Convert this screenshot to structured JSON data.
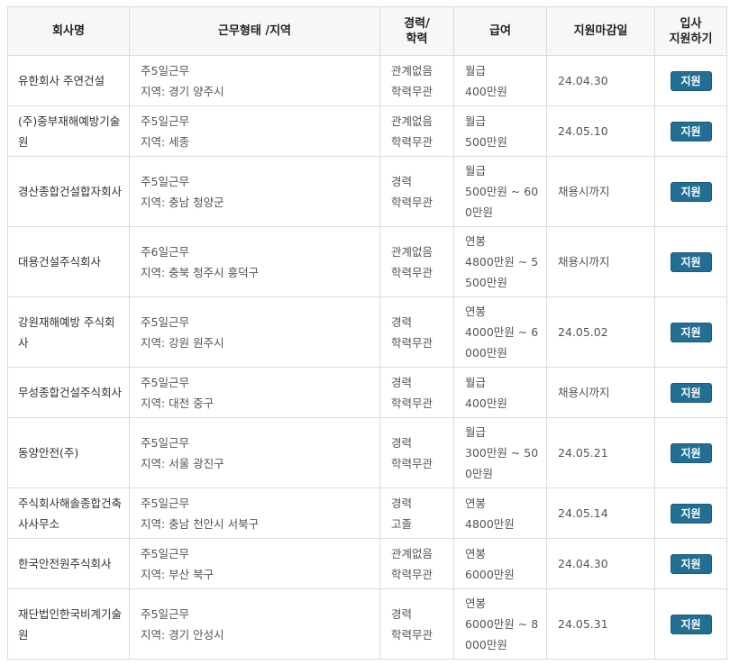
{
  "headers": {
    "company": "회사명",
    "work": "근무형태 /지역",
    "career": "경력/\n학력",
    "salary": "급여",
    "deadline": "지원마감일",
    "apply": "입사\n지원하기"
  },
  "apply_label": "지원",
  "rows": [
    {
      "company": "유한회사 주연건설",
      "work_type": "주5일근무",
      "region": "지역: 경기 양주시",
      "career": "관계없음",
      "education": "학력무관",
      "salary_type": "월급",
      "salary": "400만원",
      "deadline": "24.04.30"
    },
    {
      "company": "(주)중부재해예방기술원",
      "work_type": "주5일근무",
      "region": "지역: 세종",
      "career": "관계없음",
      "education": "학력무관",
      "salary_type": "월급",
      "salary": "500만원",
      "deadline": "24.05.10"
    },
    {
      "company": "경산종합건설합자회사",
      "work_type": "주5일근무",
      "region": "지역: 충남 청양군",
      "career": "경력",
      "education": "학력무관",
      "salary_type": "월급",
      "salary": "500만원 ~ 600만원",
      "deadline": "채용시까지"
    },
    {
      "company": "대용건설주식회사",
      "work_type": "주6일근무",
      "region": "지역: 충북 청주시 흥덕구",
      "career": "관계없음",
      "education": "학력무관",
      "salary_type": "연봉",
      "salary": "4800만원 ~ 5500만원",
      "deadline": "채용시까지"
    },
    {
      "company": "강원재해예방 주식회사",
      "work_type": "주5일근무",
      "region": "지역: 강원 원주시",
      "career": "경력",
      "education": "학력무관",
      "salary_type": "연봉",
      "salary": "4000만원 ~ 6000만원",
      "deadline": "24.05.02"
    },
    {
      "company": "무성종합건설주식회사",
      "work_type": "주5일근무",
      "region": "지역: 대전 중구",
      "career": "경력",
      "education": "학력무관",
      "salary_type": "월급",
      "salary": "400만원",
      "deadline": "채용시까지"
    },
    {
      "company": "동양안전(주)",
      "work_type": "주5일근무",
      "region": "지역: 서울 광진구",
      "career": "경력",
      "education": "학력무관",
      "salary_type": "월급",
      "salary": "300만원 ~ 500만원",
      "deadline": "24.05.21"
    },
    {
      "company": "주식회사해솔종합건축사사무소",
      "work_type": "주5일근무",
      "region": "지역: 충남 천안시 서북구",
      "career": "경력",
      "education": "고졸",
      "salary_type": "연봉",
      "salary": "4800만원",
      "deadline": "24.05.14"
    },
    {
      "company": "한국안전원주식회사",
      "work_type": "주5일근무",
      "region": "지역: 부산 북구",
      "career": "관계없음",
      "education": "학력무관",
      "salary_type": "연봉",
      "salary": "6000만원",
      "deadline": "24.04.30"
    },
    {
      "company": "재단법인한국비계기술원",
      "work_type": "주5일근무",
      "region": "지역: 경기 안성시",
      "career": "경력",
      "education": "학력무관",
      "salary_type": "연봉",
      "salary": "6000만원 ~ 8000만원",
      "deadline": "24.05.31"
    }
  ]
}
